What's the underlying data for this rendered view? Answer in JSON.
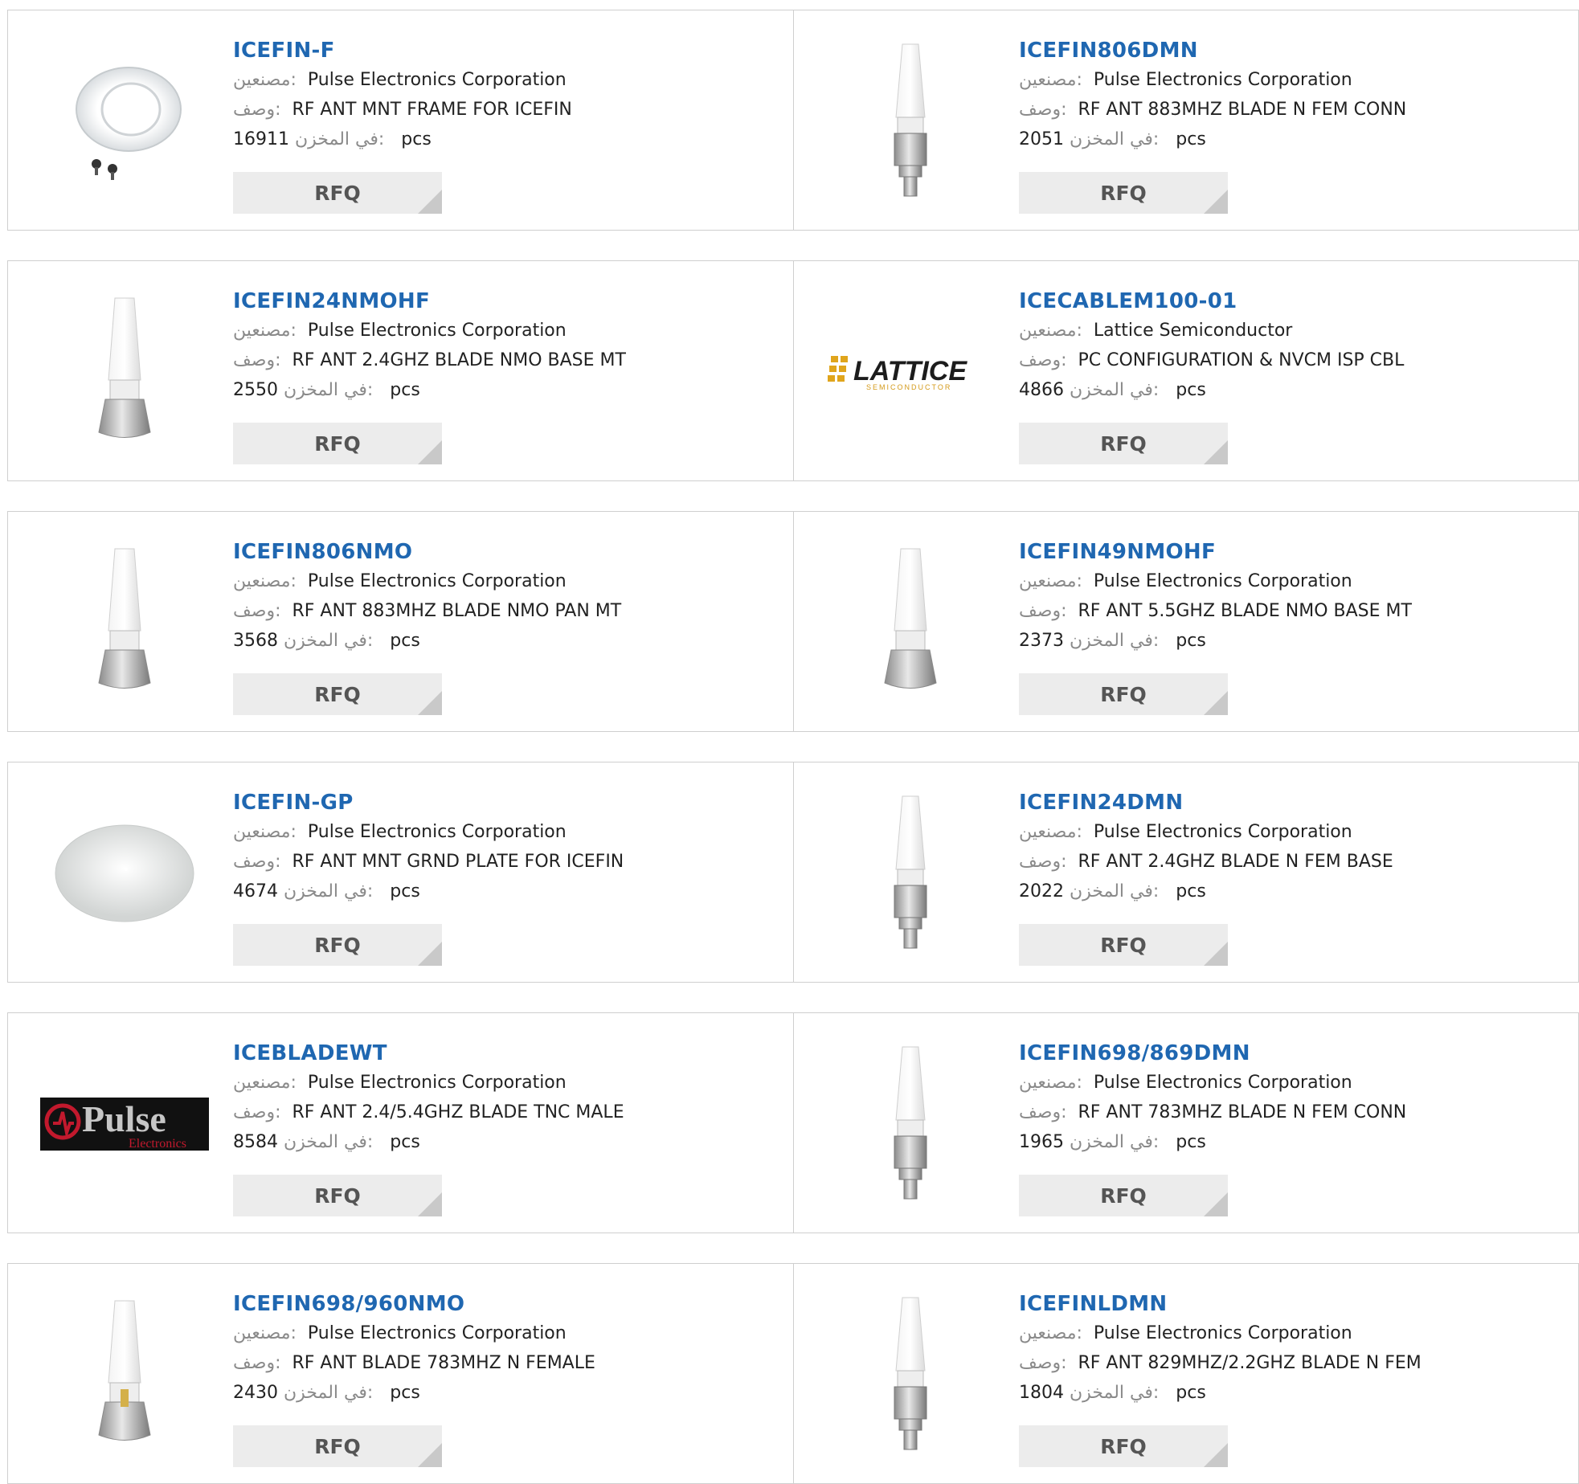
{
  "labels": {
    "manufacturer": "مصنعين:",
    "description": "وصف:",
    "stock": "في المخزن:",
    "unit": "pcs",
    "rfq": "RFQ"
  },
  "products": [
    {
      "pn": "ICEFIN-F",
      "manufacturer": "Pulse Electronics Corporation",
      "description": "RF ANT MNT FRAME FOR ICEFIN",
      "stock": "16911",
      "image": "mounting-frame"
    },
    {
      "pn": "ICEFIN806DMN",
      "manufacturer": "Pulse Electronics Corporation",
      "description": "RF ANT 883MHZ BLADE N FEM CONN",
      "stock": "2051",
      "image": "blade-antenna-n-connector"
    },
    {
      "pn": "ICEFIN24NMOHF",
      "manufacturer": "Pulse Electronics Corporation",
      "description": "RF ANT 2.4GHZ BLADE NMO BASE MT",
      "stock": "2550",
      "image": "blade-antenna-nmo"
    },
    {
      "pn": "ICECABLEM100-01",
      "manufacturer": "Lattice Semiconductor",
      "description": "PC CONFIGURATION & NVCM ISP CBL",
      "stock": "4866",
      "image": "lattice-logo"
    },
    {
      "pn": "ICEFIN806NMO",
      "manufacturer": "Pulse Electronics Corporation",
      "description": "RF ANT 883MHZ BLADE NMO PAN MT",
      "stock": "3568",
      "image": "blade-antenna-nmo"
    },
    {
      "pn": "ICEFIN49NMOHF",
      "manufacturer": "Pulse Electronics Corporation",
      "description": "RF ANT 5.5GHZ BLADE NMO BASE MT",
      "stock": "2373",
      "image": "blade-antenna-nmo"
    },
    {
      "pn": "ICEFIN-GP",
      "manufacturer": "Pulse Electronics Corporation",
      "description": "RF ANT MNT GRND PLATE FOR ICEFIN",
      "stock": "4674",
      "image": "ground-plate"
    },
    {
      "pn": "ICEFIN24DMN",
      "manufacturer": "Pulse Electronics Corporation",
      "description": "RF ANT 2.4GHZ BLADE N FEM BASE",
      "stock": "2022",
      "image": "blade-antenna-n-connector"
    },
    {
      "pn": "ICEBLADEWT",
      "manufacturer": "Pulse Electronics Corporation",
      "description": "RF ANT 2.4/5.4GHZ BLADE TNC MALE",
      "stock": "8584",
      "image": "pulse-logo"
    },
    {
      "pn": "ICEFIN698/869DMN",
      "manufacturer": "Pulse Electronics Corporation",
      "description": "RF ANT 783MHZ BLADE N FEM CONN",
      "stock": "1965",
      "image": "blade-antenna-n-connector"
    },
    {
      "pn": "ICEFIN698/960NMO",
      "manufacturer": "Pulse Electronics Corporation",
      "description": "RF ANT BLADE 783MHZ N FEMALE",
      "stock": "2430",
      "image": "blade-antenna-nmo-pin"
    },
    {
      "pn": "ICEFINLDMN",
      "manufacturer": "Pulse Electronics Corporation",
      "description": "RF ANT 829MHZ/2.2GHZ BLADE N FEM",
      "stock": "1804",
      "image": "blade-antenna-n-connector"
    }
  ],
  "logos": {
    "lattice": {
      "word": "LATTICE",
      "sub": "SEMICONDUCTOR"
    },
    "pulse": {
      "word": "Pulse",
      "sub": "Electronics"
    }
  },
  "colors": {
    "link": "#1f67b1",
    "rfq_bg": "#ececec",
    "border": "#cfcfcf"
  }
}
